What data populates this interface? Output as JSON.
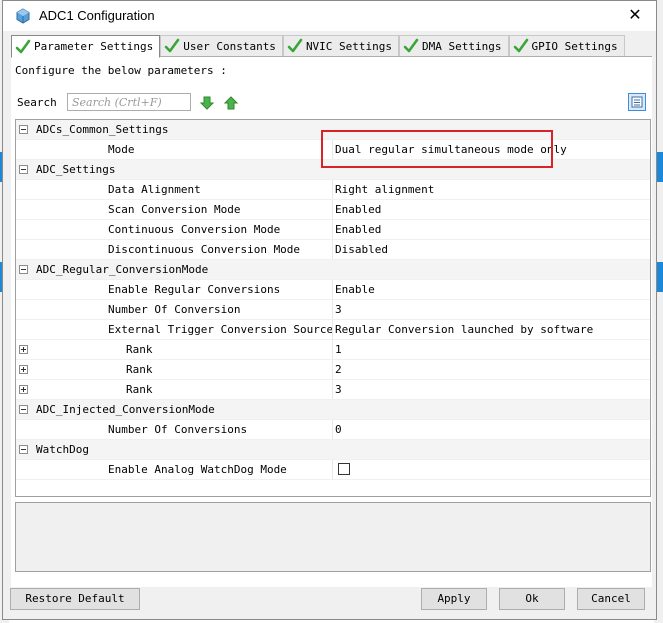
{
  "window": {
    "title": "ADC1 Configuration"
  },
  "tabs": [
    {
      "label": "Parameter Settings",
      "active": true
    },
    {
      "label": "User Constants",
      "active": false
    },
    {
      "label": "NVIC Settings",
      "active": false
    },
    {
      "label": "DMA Settings",
      "active": false
    },
    {
      "label": "GPIO Settings",
      "active": false
    }
  ],
  "panel": {
    "configure_label": "Configure the below parameters :",
    "search_label": "Search",
    "search_placeholder": "Search (Crtl+F)"
  },
  "tree": {
    "groups": {
      "common": "ADCs_Common_Settings",
      "adc": "ADC_Settings",
      "regular": "ADC_Regular_ConversionMode",
      "injected": "ADC_Injected_ConversionMode",
      "watchdog": "WatchDog"
    },
    "params": {
      "mode": {
        "name": "Mode",
        "value": "Dual regular simultaneous mode only"
      },
      "data_alignment": {
        "name": "Data Alignment",
        "value": "Right alignment"
      },
      "scan": {
        "name": "Scan Conversion Mode",
        "value": "Enabled"
      },
      "continuous": {
        "name": "Continuous Conversion Mode",
        "value": "Enabled"
      },
      "discontinuous": {
        "name": "Discontinuous Conversion Mode",
        "value": "Disabled"
      },
      "enable_regular": {
        "name": "Enable Regular Conversions",
        "value": "Enable"
      },
      "num_conversion": {
        "name": "Number Of Conversion",
        "value": "3"
      },
      "ext_trigger": {
        "name": "External Trigger Conversion Source",
        "value": "Regular Conversion launched by software"
      },
      "rank1": {
        "name": "Rank",
        "value": "1"
      },
      "rank2": {
        "name": "Rank",
        "value": "2"
      },
      "rank3": {
        "name": "Rank",
        "value": "3"
      },
      "num_injected": {
        "name": "Number Of Conversions",
        "value": "0"
      },
      "watchdog_enable": {
        "name": "Enable Analog WatchDog Mode",
        "checked": false
      }
    }
  },
  "buttons": {
    "restore": "Restore Default",
    "apply": "Apply",
    "ok": "Ok",
    "cancel": "Cancel"
  },
  "colors": {
    "highlight": "#d9232b",
    "check": "#3aa53a",
    "accent": "#1e88d8"
  }
}
